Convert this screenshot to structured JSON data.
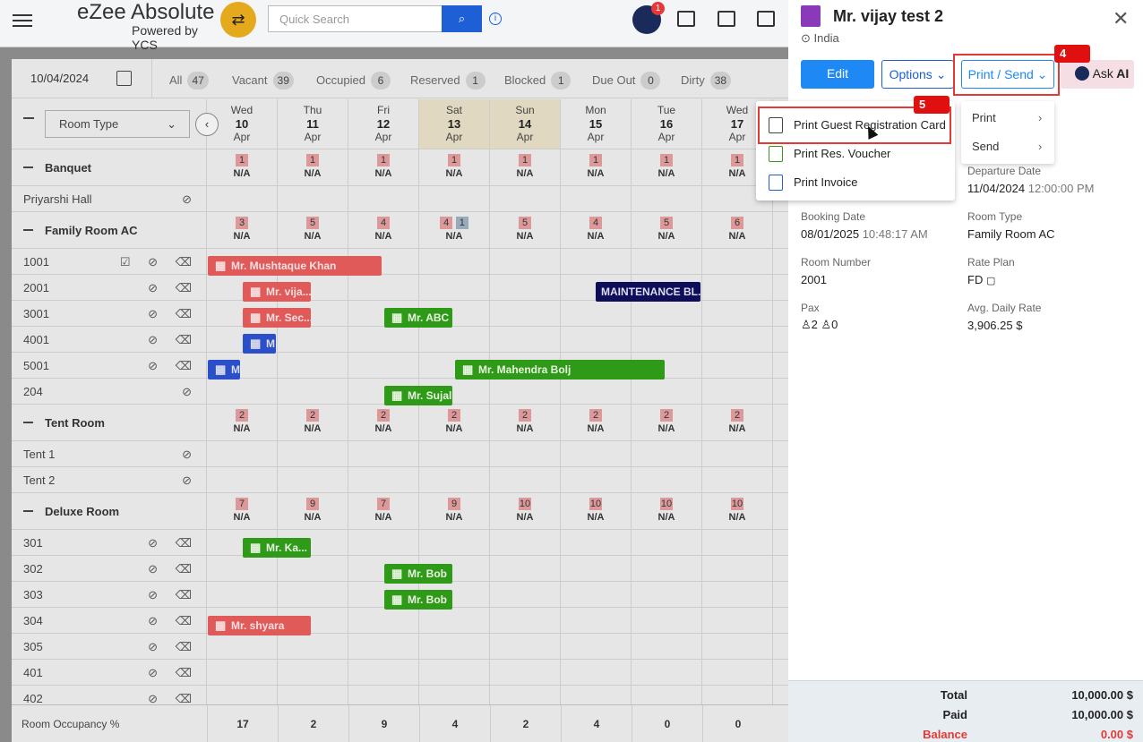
{
  "header": {
    "logo_title": "eZee Absolute",
    "logo_sub": "Powered by YCS",
    "search_placeholder": "Quick Search",
    "notif": "1"
  },
  "toolbar": {
    "date": "10/04/2024",
    "filters": [
      {
        "label": "All",
        "count": "47"
      },
      {
        "label": "Vacant",
        "count": "39"
      },
      {
        "label": "Occupied",
        "count": "6"
      },
      {
        "label": "Reserved",
        "count": "1"
      },
      {
        "label": "Blocked",
        "count": "1"
      },
      {
        "label": "Due Out",
        "count": "0"
      },
      {
        "label": "Dirty",
        "count": "38"
      }
    ]
  },
  "grid": {
    "room_type_select": "Room Type",
    "days": [
      {
        "dow": "Wed",
        "d": "10",
        "m": "Apr"
      },
      {
        "dow": "Thu",
        "d": "11",
        "m": "Apr"
      },
      {
        "dow": "Fri",
        "d": "12",
        "m": "Apr"
      },
      {
        "dow": "Sat",
        "d": "13",
        "m": "Apr"
      },
      {
        "dow": "Sun",
        "d": "14",
        "m": "Apr"
      },
      {
        "dow": "Mon",
        "d": "15",
        "m": "Apr"
      },
      {
        "dow": "Tue",
        "d": "16",
        "m": "Apr"
      },
      {
        "dow": "Wed",
        "d": "17",
        "m": "Apr"
      }
    ],
    "na": "N/A",
    "categories": [
      {
        "name": "Banquet",
        "avail": [
          "1",
          "1",
          "1",
          "1",
          "1",
          "1",
          "1",
          "1"
        ],
        "rooms": [
          "Priyarshi Hall"
        ]
      },
      {
        "name": "Family Room AC",
        "avail": [
          "3",
          "5",
          "4",
          "4",
          "5",
          "4",
          "5",
          "6"
        ],
        "blocked": "1",
        "rooms": [
          "1001",
          "2001",
          "3001",
          "4001",
          "5001",
          "204"
        ]
      },
      {
        "name": "Tent Room",
        "avail": [
          "2",
          "2",
          "2",
          "2",
          "2",
          "2",
          "2",
          "2"
        ],
        "rooms": [
          "Tent 1",
          "Tent 2"
        ]
      },
      {
        "name": "Deluxe Room",
        "avail": [
          "7",
          "9",
          "7",
          "9",
          "10",
          "10",
          "10",
          "10"
        ],
        "rooms": [
          "301",
          "302",
          "303",
          "304",
          "305",
          "401",
          "402"
        ]
      }
    ],
    "bookings": [
      "Mr. Mushtaque Khan",
      "Mr. vija...",
      "Mr. Sec...",
      "Mr. ABC",
      "M",
      "M",
      "Mr. Mahendra Bolj",
      "Mr. Sujal",
      "MAINTENANCE BL...",
      "Mr. Ka...",
      "Mr. Bob",
      "Mr. Bob",
      "Mr. shyara"
    ],
    "footer_label": "Room Occupancy %",
    "occupancy": [
      "17",
      "2",
      "9",
      "4",
      "2",
      "4",
      "0",
      "0"
    ]
  },
  "panel": {
    "title": "Mr. vijay test 2",
    "location": "India",
    "edit": "Edit",
    "options": "Options",
    "print_send": "Print / Send",
    "ask": "Ask",
    "ai": "AI",
    "step4": "4",
    "step5": "5",
    "fields": {
      "departure_label": "Departure Date",
      "departure_date": "11/04/2024",
      "departure_time": "12:00:00 PM",
      "booking_label": "Booking Date",
      "booking_date": "08/01/2025",
      "booking_time": "10:48:17 AM",
      "roomtype_label": "Room Type",
      "roomtype": "Family Room AC",
      "roomno_label": "Room Number",
      "roomno": "2001",
      "rateplan_label": "Rate Plan",
      "rateplan": "FD",
      "pax_label": "Pax",
      "pax_adult": "2",
      "pax_child": "0",
      "adr_label": "Avg. Daily Rate",
      "adr": "3,906.25 $"
    },
    "totals": {
      "total_label": "Total",
      "total": "10,000.00 $",
      "paid_label": "Paid",
      "paid": "10,000.00 $",
      "balance_label": "Balance",
      "balance": "0.00 $"
    }
  },
  "menu_print": [
    "Print Guest Registration Card",
    "Print Res. Voucher",
    "Print Invoice"
  ],
  "menu_sub": [
    "Print",
    "Send"
  ],
  "colors": {
    "accent": "#1e88f5",
    "booking_red": "#e05a5a",
    "booking_green": "#2e9a18",
    "highlight": "#e53935"
  }
}
